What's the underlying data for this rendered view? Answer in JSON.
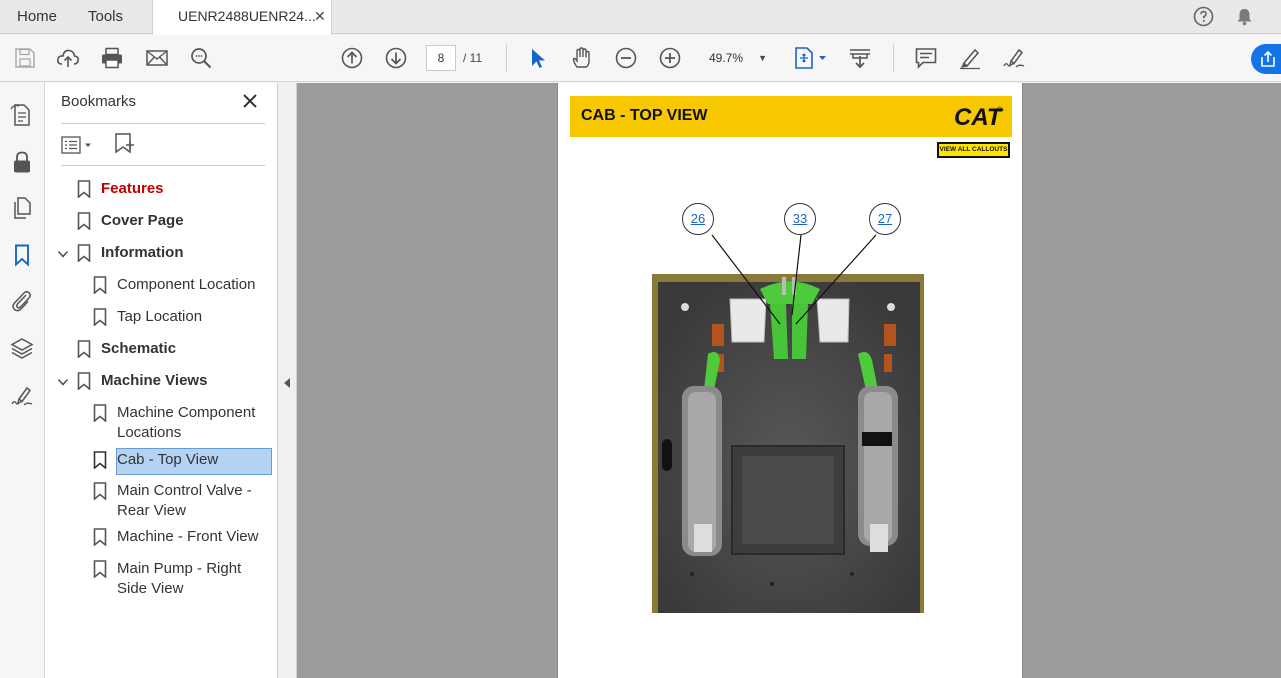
{
  "tabs": {
    "home": "Home",
    "tools": "Tools",
    "document": "UENR2488UENR24...",
    "close_glyph": "✕"
  },
  "toolbar": {
    "current_page": "8",
    "page_total": "/ 11",
    "zoom": "49.7%"
  },
  "bookmarks_panel": {
    "title": "Bookmarks",
    "items": [
      {
        "label": "Features"
      },
      {
        "label": "Cover Page"
      },
      {
        "label": "Information"
      },
      {
        "label": "Component Location"
      },
      {
        "label": "Tap Location"
      },
      {
        "label": "Schematic"
      },
      {
        "label": "Machine Views"
      },
      {
        "label": "Machine Component",
        "label2": "Locations"
      },
      {
        "label": "Cab - Top View"
      },
      {
        "label": "Main Control Valve -",
        "label2": "Rear View"
      },
      {
        "label": "Machine - Front View"
      },
      {
        "label": "Main Pump - Right",
        "label2": "Side View"
      }
    ]
  },
  "document": {
    "header_title": "CAB - TOP VIEW",
    "logo_text": "CAT",
    "view_all_callouts": "VIEW ALL CALLOUTS",
    "callouts": [
      "26",
      "33",
      "27"
    ]
  },
  "colors": {
    "accent_blue": "#1473e6",
    "header_yellow": "#f7c700",
    "selected_bookmark": "#b4d3f2",
    "features_red": "#c00000"
  }
}
